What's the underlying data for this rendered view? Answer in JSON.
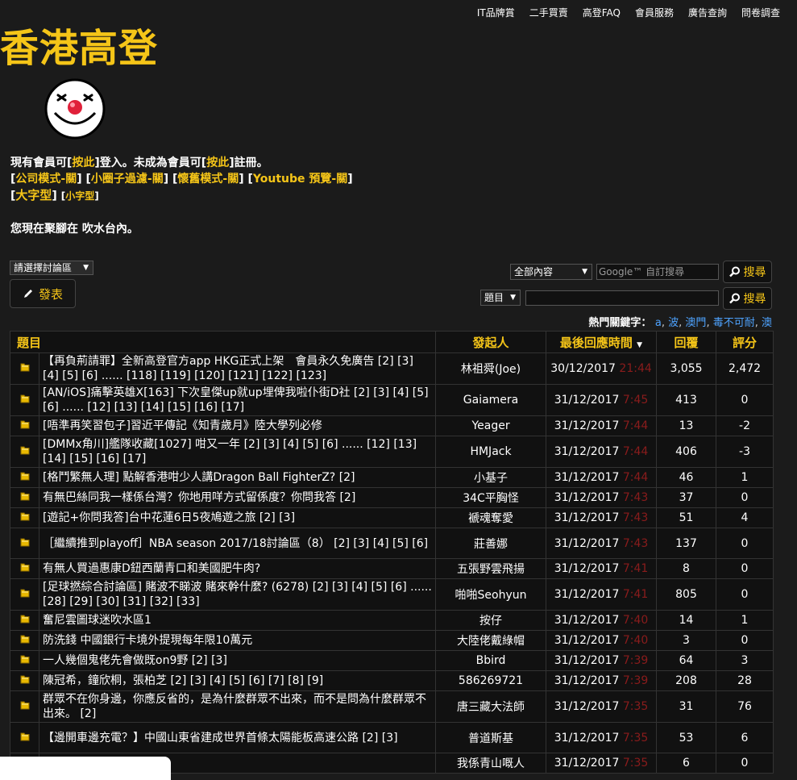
{
  "nav": [
    "IT品牌賞",
    "二手買賣",
    "高登FAQ",
    "會員服務",
    "廣告查詢",
    "問卷調查"
  ],
  "logo": "香港高登",
  "intro": {
    "line1_a": "現有會員可[",
    "line1_link1": "按此",
    "line1_b": "]登入。未成為會員可[",
    "line1_link2": "按此",
    "line1_c": "]註冊。",
    "modes": [
      "公司模式-關",
      "小圈子過濾-關",
      "懷舊模式-關",
      "Youtube 預覽-關"
    ],
    "size_large": "大字型",
    "size_small": "小字型"
  },
  "location": "您現在聚腳在 吹水台內。",
  "forum_select": "請選擇討論區",
  "post_button": "發表",
  "search": {
    "scope": "全部內容",
    "placeholder": "Google™ 自訂搜尋",
    "button": "搜尋",
    "topic_select": "題目",
    "button2": "搜尋"
  },
  "hotkeys": {
    "label": "熱門關鍵字：",
    "items": [
      "a",
      "波",
      "澳門",
      "毒不可耐",
      "澳"
    ]
  },
  "table": {
    "headers": {
      "title": "題目",
      "author": "發起人",
      "last": "最後回應時間",
      "replies": "回覆",
      "rating": "評分"
    },
    "rows": [
      {
        "title": "【再負荊請罪】全新高登官方app HKG正式上架　會員永久免廣告 [2] [3] [4] [5] [6] ...... [118] [119] [120] [121] [122] [123]",
        "author": "林祖舜(Joe)",
        "date": "30/12/2017",
        "time": "21:44",
        "replies": "3,055",
        "rating": "2,472"
      },
      {
        "title": "[AN/iOS]痛擊英雄X[163] 下次皇傑up就up埋俾我啦仆街D社 [2] [3] [4] [5] [6] ...... [12] [13] [14] [15] [16] [17]",
        "author": "Gaiamera",
        "date": "31/12/2017",
        "time": "7:45",
        "replies": "413",
        "rating": "0"
      },
      {
        "title": "[唔準再笑習包子]習近平傳記《知青歲月》陸大學列必修",
        "author": "Yeager",
        "date": "31/12/2017",
        "time": "7:44",
        "replies": "13",
        "rating": "-2"
      },
      {
        "title": "[DMMx角川]艦隊收藏[1027] 咁又一年 [2] [3] [4] [5] [6] ...... [12] [13] [14] [15] [16] [17]",
        "author": "HMJack",
        "date": "31/12/2017",
        "time": "7:44",
        "replies": "406",
        "rating": "-3"
      },
      {
        "title": "[格鬥繁無人理] 點解香港咁少人講Dragon Ball FighterZ? [2]",
        "author": "小基子",
        "date": "31/12/2017",
        "time": "7:44",
        "replies": "46",
        "rating": "1"
      },
      {
        "title": "有無巴絲同我一樣係台灣？你地用咩方式留係度？你問我答 [2]",
        "author": "34C平胸怪",
        "date": "31/12/2017",
        "time": "7:43",
        "replies": "37",
        "rating": "0"
      },
      {
        "title": "[遊記+你問我答]台中花蓮6日5夜鳩遊之旅 [2] [3]",
        "author": "褫魂奪愛",
        "date": "31/12/2017",
        "time": "7:43",
        "replies": "51",
        "rating": "4"
      },
      {
        "title": "［繼續推到playoff］NBA season 2017/18討論區（8） [2] [3] [4] [5] [6]",
        "author": "莊善娜",
        "date": "31/12/2017",
        "time": "7:43",
        "replies": "137",
        "rating": "0"
      },
      {
        "title": "有無人買過惠康D鈕西蘭青口和美國肥牛肉?",
        "author": "五張野雲飛揚",
        "date": "31/12/2017",
        "time": "7:41",
        "replies": "8",
        "rating": "0"
      },
      {
        "title": "[足球撚綜合討論區] 賭波不睇波 賭來幹什麼? (6278) [2] [3] [4] [5] [6] ...... [28] [29] [30] [31] [32] [33]",
        "author": "啪啪Seohyun",
        "date": "31/12/2017",
        "time": "7:41",
        "replies": "805",
        "rating": "0"
      },
      {
        "title": "奮尼雲圖球迷吹水區1",
        "author": "按仔",
        "date": "31/12/2017",
        "time": "7:40",
        "replies": "14",
        "rating": "1"
      },
      {
        "title": "防洗錢 中國銀行卡境外提現每年限10萬元",
        "author": "大陸佬戴綠帽",
        "date": "31/12/2017",
        "time": "7:40",
        "replies": "3",
        "rating": "0"
      },
      {
        "title": "一人幾個鬼佬先會做既on9野 [2] [3]",
        "author": "Bbird",
        "date": "31/12/2017",
        "time": "7:39",
        "replies": "64",
        "rating": "3"
      },
      {
        "title": "陳冠希，鐘欣桐，張柏芝 [2] [3] [4] [5] [6] [7] [8] [9]",
        "author": "586269721",
        "date": "31/12/2017",
        "time": "7:39",
        "replies": "208",
        "rating": "28"
      },
      {
        "title": "群眾不在你身邊，你應反省的，是為什麼群眾不出來，而不是問為什麼群眾不出來。 [2]",
        "author": "唐三藏大法師",
        "date": "31/12/2017",
        "time": "7:35",
        "replies": "31",
        "rating": "76"
      },
      {
        "title": "【邊開車邊充電？】中國山東省建成世界首條太陽能板高速公路 [2] [3]",
        "author": "普道斯基",
        "date": "31/12/2017",
        "time": "7:35",
        "replies": "53",
        "rating": "6"
      },
      {
        "title": "",
        "author": "我係青山嘅人",
        "date": "31/12/2017",
        "time": "7:35",
        "replies": "6",
        "rating": "0"
      }
    ]
  }
}
